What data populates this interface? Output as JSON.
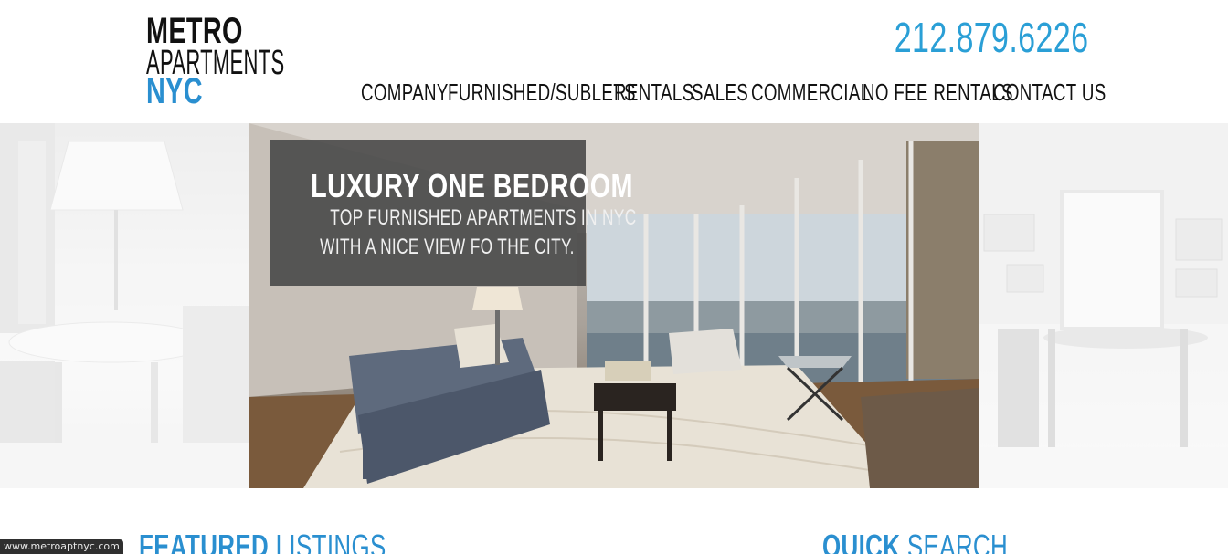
{
  "logo": {
    "line1": "METRO",
    "line2": "APARTMENTS",
    "line3": "NYC"
  },
  "header": {
    "phone": "212.879.6226"
  },
  "nav": {
    "items": [
      {
        "label": "COMPANY"
      },
      {
        "label": "FURNISHED/SUBLETS"
      },
      {
        "label": "RENTALS"
      },
      {
        "label": "SALES"
      },
      {
        "label": "COMMERCIAL"
      },
      {
        "label": "NO FEE RENTALS"
      },
      {
        "label": "CONTACT US"
      }
    ]
  },
  "hero": {
    "title": "LUXURY ONE BEDROOM",
    "subtitle_line1": "TOP FURNISHED APARTMENTS IN NYC",
    "subtitle_line2": "WITH A NICE VIEW FO THE CITY."
  },
  "featured": {
    "bold": "FEATURED",
    "light": "LISTINGS"
  },
  "quick_search": {
    "bold": "QUICK",
    "light": "SEARCH"
  },
  "status_bar": {
    "url": "www.metroaptnyc.com"
  },
  "colors": {
    "accent": "#2a8fd0",
    "phone": "#2a9fd6",
    "text": "#111111",
    "caption_bg": "#464646"
  }
}
